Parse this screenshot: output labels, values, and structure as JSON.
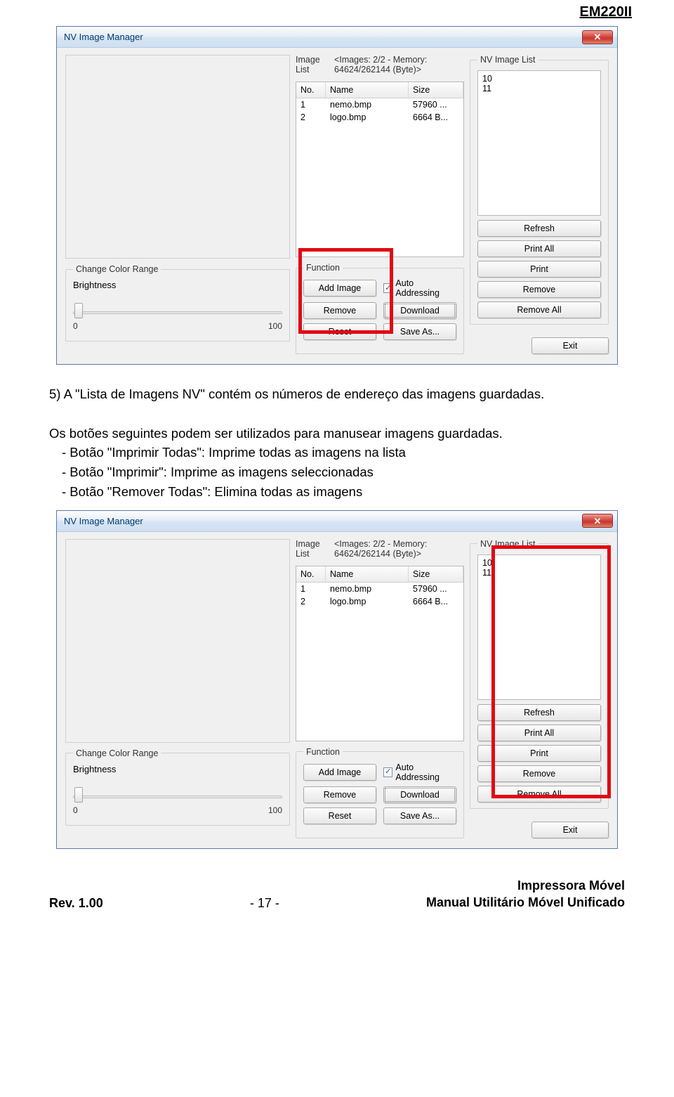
{
  "header": {
    "model": "EM220II"
  },
  "dialog": {
    "title": "NV Image Manager",
    "image_list_label": "Image List",
    "image_list_status": "<Images: 2/2 - Memory: 64624/262144 (Byte)>",
    "columns": {
      "no": "No.",
      "name": "Name",
      "size": "Size"
    },
    "rows": [
      {
        "no": "1",
        "name": "nemo.bmp",
        "size": "57960 ..."
      },
      {
        "no": "2",
        "name": "logo.bmp",
        "size": "6664 B..."
      }
    ],
    "color_range": {
      "legend": "Change Color Range",
      "label": "Brightness",
      "min": "0",
      "max": "100"
    },
    "function": {
      "legend": "Function",
      "add_image": "Add Image",
      "remove": "Remove",
      "reset": "Reset",
      "auto_addressing": "Auto Addressing",
      "download": "Download",
      "save_as": "Save As..."
    },
    "nv_list": {
      "legend": "NV Image List",
      "items": [
        "10",
        "11"
      ],
      "buttons": {
        "refresh": "Refresh",
        "print_all": "Print All",
        "print": "Print",
        "remove": "Remove",
        "remove_all": "Remove All"
      },
      "exit": "Exit"
    }
  },
  "doc": {
    "p1": "5) A \"Lista de Imagens NV\" contém os números de endereço das imagens guardadas.",
    "p2": "Os botões seguintes podem ser utilizados para manusear imagens guardadas.",
    "b1": "- Botão \"Imprimir Todas\": Imprime todas as imagens na lista",
    "b2": "- Botão \"Imprimir\": Imprime as imagens seleccionadas",
    "b3": "- Botão \"Remover Todas\": Elimina todas as imagens"
  },
  "footer": {
    "rev": "Rev. 1.00",
    "page": "- 17 -",
    "right1": "Impressora Móvel",
    "right2": "Manual Utilitário Móvel Unificado"
  }
}
